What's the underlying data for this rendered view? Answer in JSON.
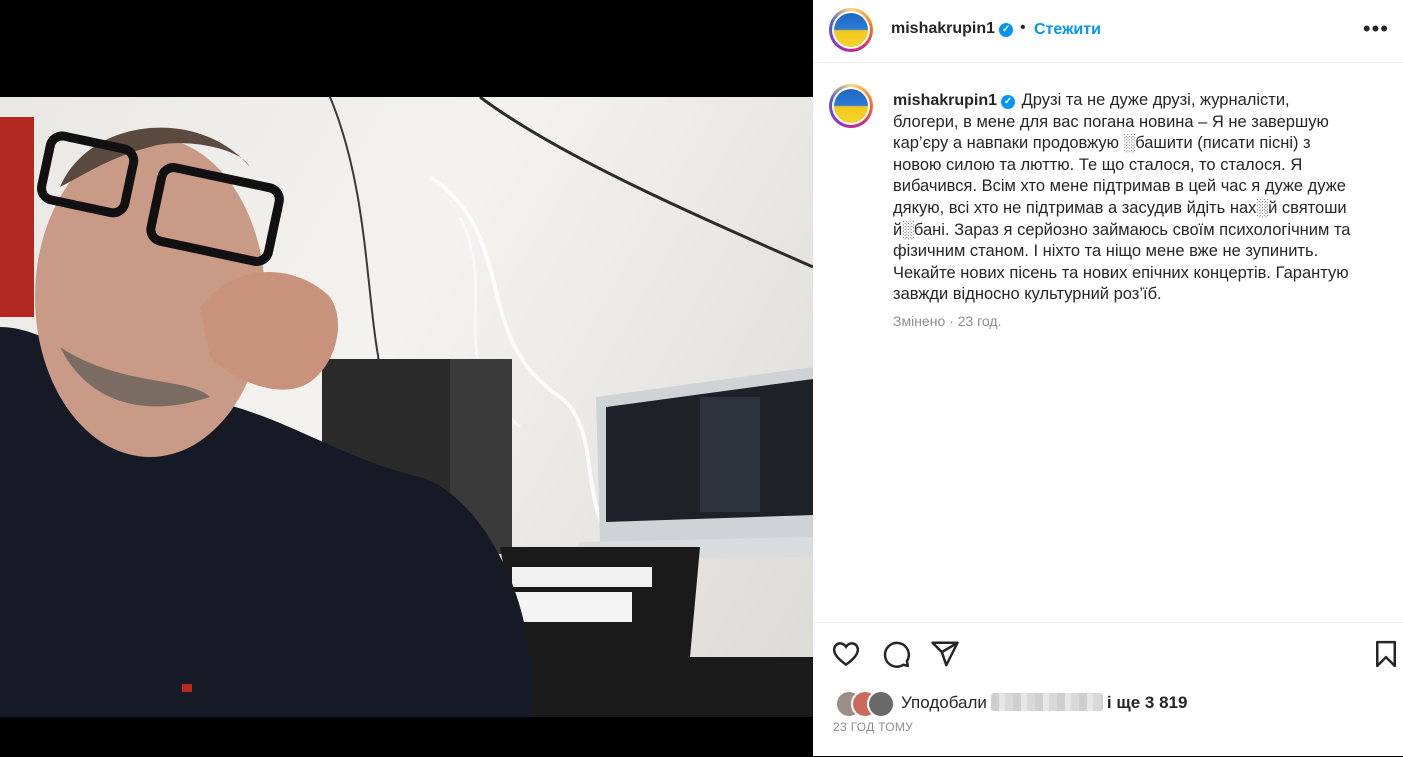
{
  "post": {
    "username": "mishakrupin1",
    "verified_mark": "✓",
    "separator": "•",
    "follow_label": "Стежити",
    "more_label": "•••",
    "caption": "Друзі та не дуже друзі, журналісти, блогери, в мене для вас погана новина – Я не завершую кар’єру а навпаки продовжую ░башити (писати пісні) з новою силою та люттю. Те що сталося, то сталося. Я вибачився. Всім хто мене підтримав в цей час я дуже дуже дякую, всі хто не підтримав а засудив йдіть нах░й святоши й░бані. Зараз я серйозно займаюсь своїм психологічним та фізичним станом. І ніхто та ніщо мене вже не зупинить. Чекайте нових пісень та нових епічних концертів. Гарантую завжди відносно культурний роз’їб.",
    "caption_meta": "Змінено · 23 год.",
    "likes_prefix": "Уподобали",
    "likes_suffix": "і ще 3 819",
    "timestamp": "23 ГОД ТОМУ"
  },
  "icons": {
    "like": "heart-icon",
    "comment": "comment-icon",
    "share": "send-icon",
    "save": "bookmark-icon",
    "avatar": "ukraine-flag-avatar"
  },
  "colors": {
    "accent": "#0095f6",
    "muted": "#8e8e8e",
    "flag_blue": "#1f67c4",
    "flag_yellow": "#f7d42a"
  }
}
